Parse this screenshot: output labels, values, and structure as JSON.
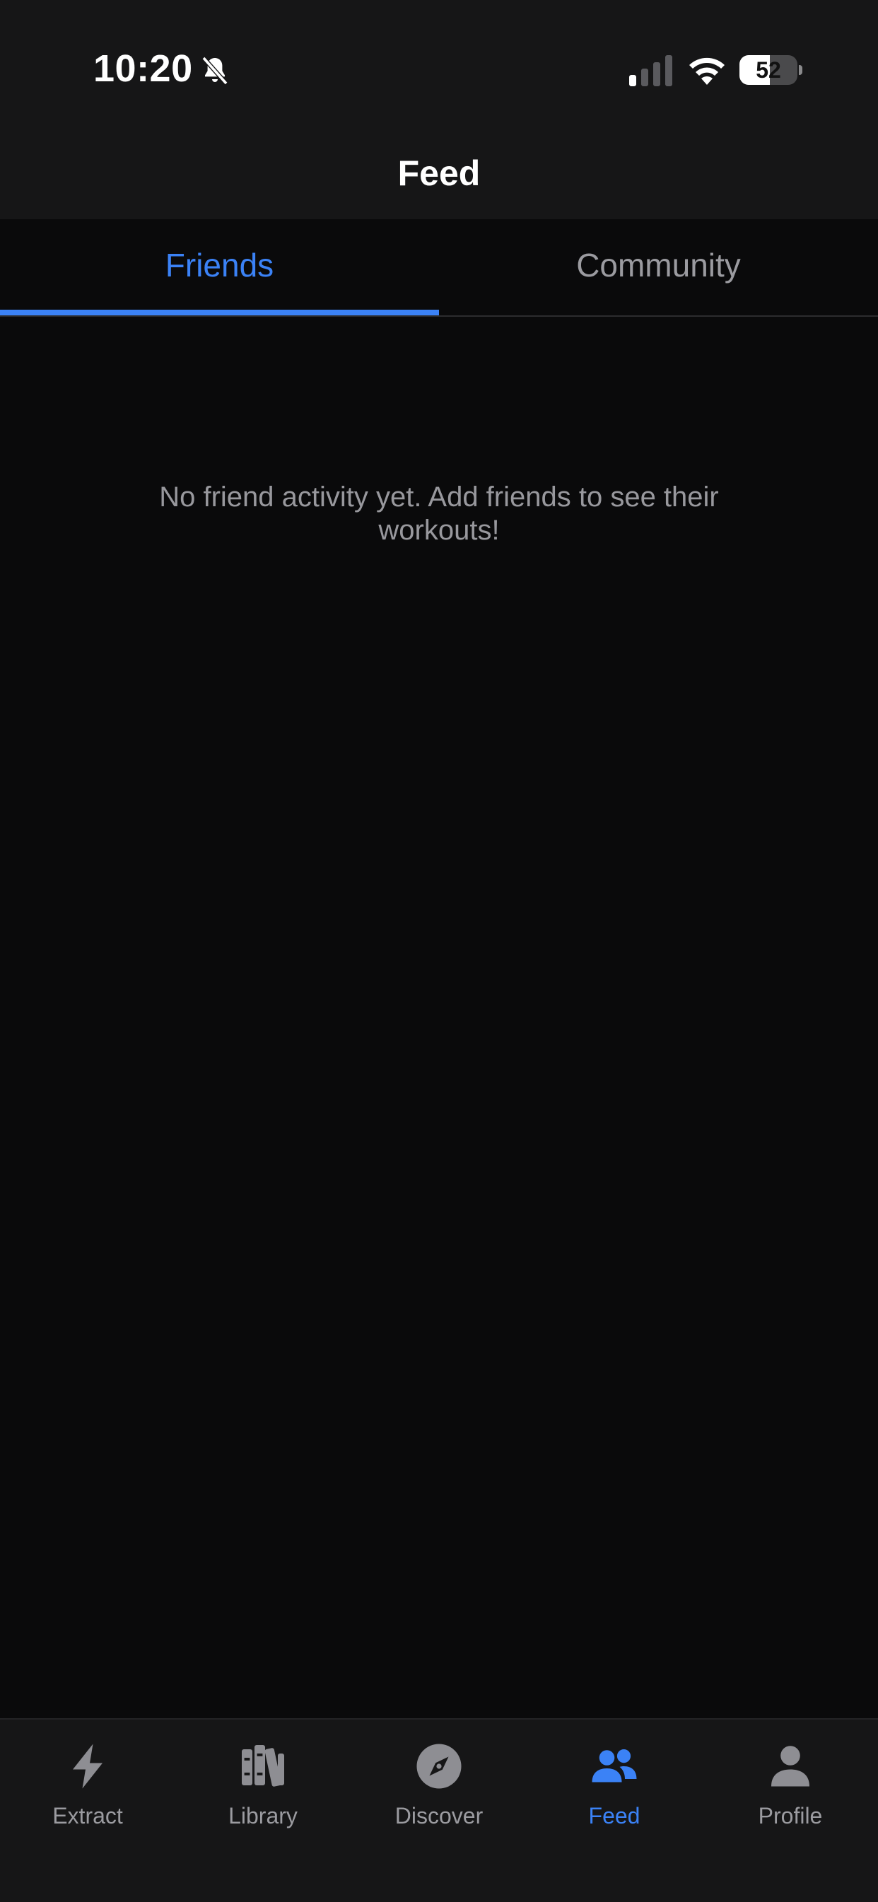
{
  "status_bar": {
    "time": "10:20",
    "battery_level": "52",
    "battery_fraction": 0.52,
    "icons": [
      "bell-slash-icon",
      "cellular-signal-icon",
      "wifi-icon",
      "battery-icon"
    ]
  },
  "header": {
    "title": "Feed"
  },
  "tabs": [
    {
      "label": "Friends",
      "active": true
    },
    {
      "label": "Community",
      "active": false
    }
  ],
  "feed": {
    "empty_message": "No friend activity yet. Add friends to see their workouts!"
  },
  "tab_bar": {
    "items": [
      {
        "label": "Extract",
        "icon": "lightning-bolt-icon",
        "active": false
      },
      {
        "label": "Library",
        "icon": "books-icon",
        "active": false
      },
      {
        "label": "Discover",
        "icon": "compass-icon",
        "active": false
      },
      {
        "label": "Feed",
        "icon": "people-icon",
        "active": true
      },
      {
        "label": "Profile",
        "icon": "person-icon",
        "active": false
      }
    ]
  },
  "colors": {
    "accent": "#3b82f6",
    "inactive": "#9b9ba0",
    "background": "#0a0a0b",
    "bar_background": "#161617"
  }
}
